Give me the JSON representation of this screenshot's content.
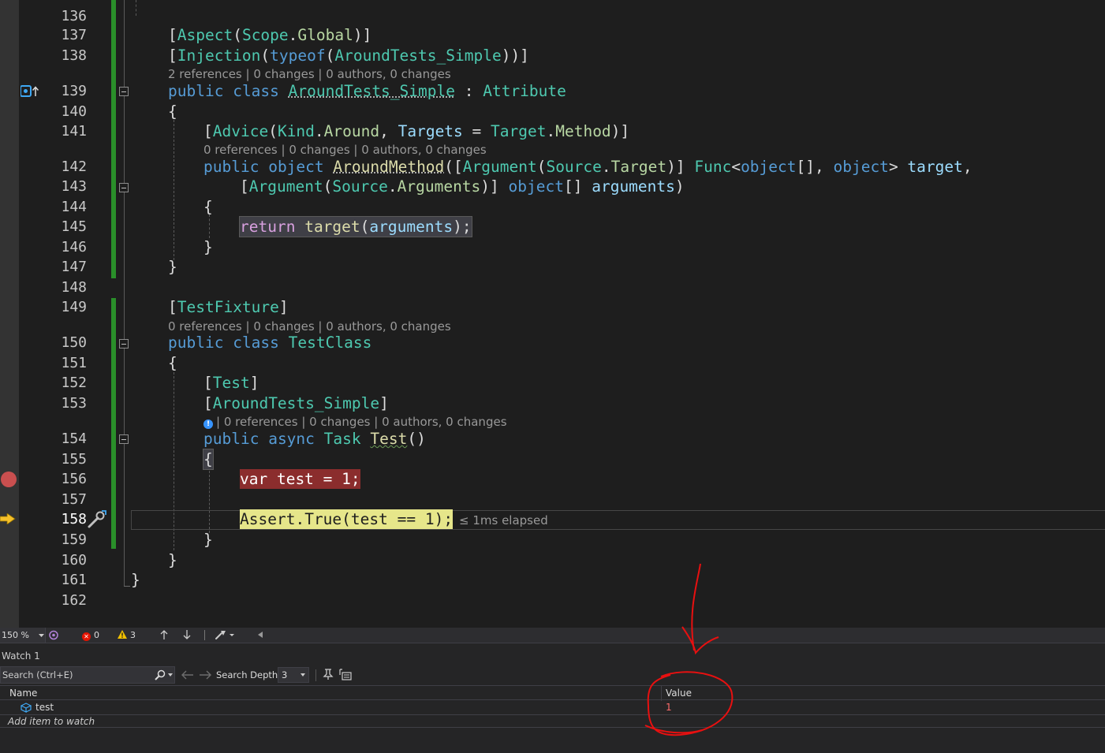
{
  "editor": {
    "lines": {
      "l136": "136",
      "l137": "137",
      "l138": "138",
      "l139": "139",
      "l140": "140",
      "l141": "141",
      "l142": "142",
      "l143": "143",
      "l144": "144",
      "l145": "145",
      "l146": "146",
      "l147": "147",
      "l148": "148",
      "l149": "149",
      "l150": "150",
      "l151": "151",
      "l152": "152",
      "l153": "153",
      "l154": "154",
      "l155": "155",
      "l156": "156",
      "l157": "157",
      "l158": "158",
      "l159": "159",
      "l160": "160",
      "l161": "161",
      "l162": "162"
    },
    "code_lens": {
      "aspect_class": "2 references | 0 changes | 0 authors, 0 changes",
      "around_method": "0 references | 0 changes | 0 authors, 0 changes",
      "test_class": "0 references | 0 changes | 0 authors, 0 changes",
      "test_method": "| 0 references | 0 changes | 0 authors, 0 changes"
    },
    "elapsed_hint": "≤ 1ms elapsed",
    "icons": {
      "breakpoint": "breakpoint-icon",
      "execution_pointer": "execution-arrow-icon",
      "bookmark": "bookmark-icon",
      "edit_and_continue": "wrench-icon"
    }
  },
  "statusbar": {
    "zoom": "150 %",
    "errors": "0",
    "warnings": "3"
  },
  "watch": {
    "title": "Watch 1",
    "search_placeholder": "Search (Ctrl+E)",
    "search_depth_label": "Search Depth:",
    "search_depth_value": "3",
    "columns": {
      "name": "Name",
      "value": "Value"
    },
    "rows": [
      {
        "name": "test",
        "value": "1"
      }
    ],
    "add_item": "Add item to watch"
  },
  "colors": {
    "keyword": "#569cd6",
    "type": "#4ec9b0",
    "method": "#dcdcaa",
    "parameter": "#9cdcfe",
    "breakpoint": "#8b2d2d",
    "current_statement": "#e6e68a",
    "annotation": "#e81010"
  }
}
